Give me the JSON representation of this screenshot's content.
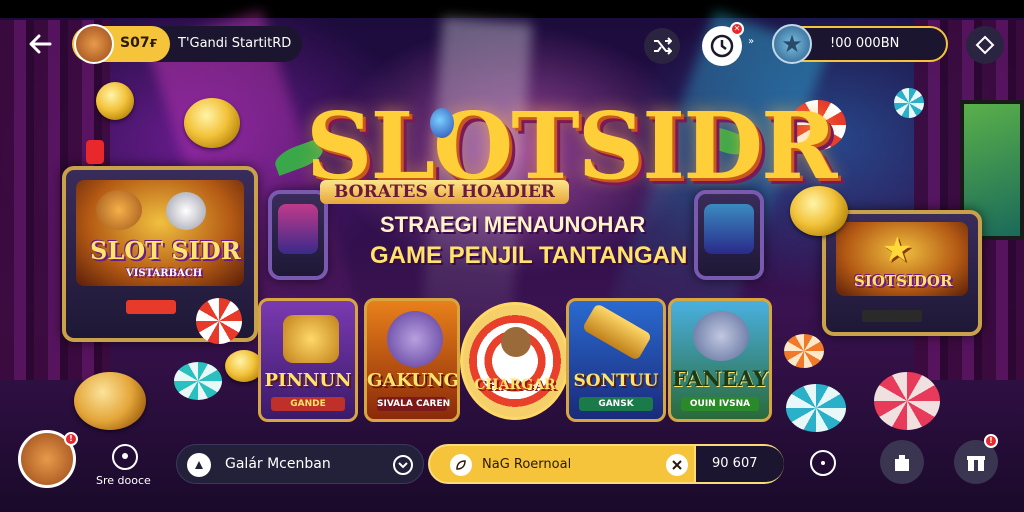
{
  "header": {
    "coin_balance": "S07ғ",
    "player_name": "T'Gandi StartitRD",
    "gem_balance": "!00 000BN"
  },
  "logo": {
    "title": "SLOTSIDR",
    "subtitle": "BORATES CI HOADIER",
    "tagline_1": "STRAEGI MENAUNOHAR",
    "tagline_2": "GAME PENJIL TANTANGAN"
  },
  "machines": {
    "left_title": "SLOT SIDR",
    "left_sub": "VISTARBACH",
    "right_title": "SIOTSIDOR"
  },
  "games": [
    {
      "title": "PINNUN",
      "badge": "GANDE"
    },
    {
      "title": "GAKUNG",
      "badge": "SIVALA CAREN"
    },
    {
      "title": "CHARGAR",
      "badge": ""
    },
    {
      "title": "SONTUU",
      "badge": "GANSK"
    },
    {
      "title": "FANEAY",
      "badge": "OUIN IVSNA"
    }
  ],
  "bottom": {
    "profile_label": "Sre dooce",
    "search_placeholder": "Galár Mcenban",
    "promo_text": "NaG Roernoal",
    "promo_value": "90 607"
  },
  "colors": {
    "accent_gold": "#f6c43a",
    "panel_dark": "#1b1530",
    "notification_red": "#e8282a"
  }
}
